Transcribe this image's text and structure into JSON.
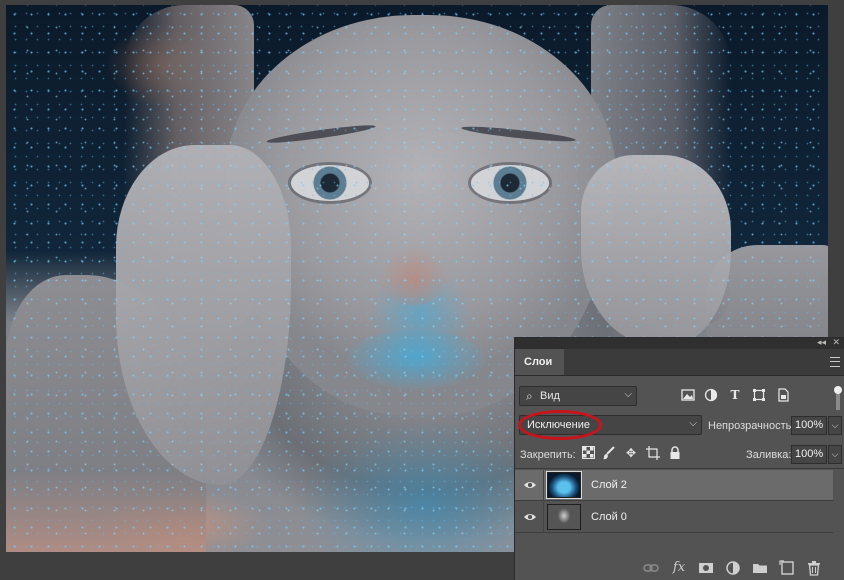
{
  "panel": {
    "tab_label": "Слои",
    "filter": {
      "label": "Вид",
      "icon": "search-icon"
    },
    "filter_icons": [
      "pixel-layer-filter-icon",
      "adjustment-layer-filter-icon",
      "type-layer-filter-icon",
      "shape-layer-filter-icon",
      "smart-object-filter-icon"
    ],
    "blend_mode": "Исключение",
    "opacity_label": "Непрозрачность:",
    "opacity_value": "100%",
    "lock_label": "Закрепить:",
    "lock_icons": [
      "lock-transparent-pixels-icon",
      "lock-image-pixels-icon",
      "lock-position-icon",
      "lock-artboard-icon",
      "lock-all-icon"
    ],
    "fill_label": "Заливка:",
    "fill_value": "100%",
    "layers": [
      {
        "name": "Слой 2",
        "selected": true,
        "visible": true,
        "thumbnail": "space-stars"
      },
      {
        "name": "Слой 0",
        "selected": false,
        "visible": true,
        "thumbnail": "portrait"
      }
    ],
    "footer_icons": [
      "link-layers-icon",
      "fx-icon",
      "add-mask-icon",
      "adjustment-layer-icon",
      "new-group-icon",
      "new-layer-icon",
      "trash-icon"
    ],
    "footer_fx": "fx"
  },
  "colors": {
    "highlight_ellipse": "#c8141a",
    "panel_bg": "#535353",
    "selected_layer_bg": "#6b6b6b"
  }
}
